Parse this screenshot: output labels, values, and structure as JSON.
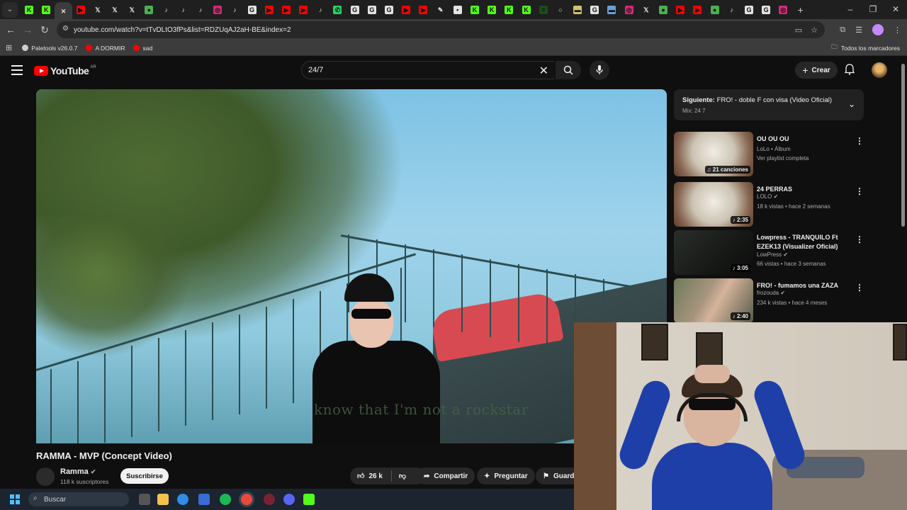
{
  "browser": {
    "tabs": [
      {
        "icon": "kick-icon",
        "color": "#53fc18",
        "glyph": "K"
      },
      {
        "icon": "kick-icon",
        "color": "#53fc18",
        "glyph": "K"
      },
      {
        "icon": "close-icon",
        "color": "#3c3c3c",
        "glyph": "✕",
        "active": true
      },
      {
        "icon": "youtube-icon",
        "color": "#ff0000",
        "glyph": "▶"
      },
      {
        "icon": "x-icon",
        "color": "#1f1f1f",
        "glyph": "𝕏"
      },
      {
        "icon": "x-icon",
        "color": "#1f1f1f",
        "glyph": "𝕏"
      },
      {
        "icon": "x-icon",
        "color": "#1f1f1f",
        "glyph": "𝕏"
      },
      {
        "icon": "xbox-icon",
        "color": "#4caf50",
        "glyph": "●"
      },
      {
        "icon": "tiktok-icon",
        "color": "#1f1f1f",
        "glyph": "♪"
      },
      {
        "icon": "tiktok-icon",
        "color": "#1f1f1f",
        "glyph": "♪"
      },
      {
        "icon": "tiktok-icon",
        "color": "#1f1f1f",
        "glyph": "♪"
      },
      {
        "icon": "instagram-icon",
        "color": "#d62976",
        "glyph": "◎"
      },
      {
        "icon": "tiktok-icon",
        "color": "#1f1f1f",
        "glyph": "♪"
      },
      {
        "icon": "chrome-icon",
        "color": "#e3e3e3",
        "glyph": "G"
      },
      {
        "icon": "youtube-icon",
        "color": "#ff0000",
        "glyph": "▶"
      },
      {
        "icon": "youtube-icon",
        "color": "#ff0000",
        "glyph": "▶"
      },
      {
        "icon": "youtube-icon",
        "color": "#ff0000",
        "glyph": "▶"
      },
      {
        "icon": "tiktok-icon",
        "color": "#1f1f1f",
        "glyph": "♪"
      },
      {
        "icon": "whatsapp-icon",
        "color": "#25d366",
        "glyph": "✆"
      },
      {
        "icon": "chrome-icon",
        "color": "#e3e3e3",
        "glyph": "G"
      },
      {
        "icon": "chrome-icon",
        "color": "#e3e3e3",
        "glyph": "G"
      },
      {
        "icon": "chrome-icon",
        "color": "#e3e3e3",
        "glyph": "G"
      },
      {
        "icon": "youtube-icon",
        "color": "#ff0000",
        "glyph": "▶"
      },
      {
        "icon": "youtube-icon",
        "color": "#ff0000",
        "glyph": "▶"
      },
      {
        "icon": "page-icon",
        "color": "#1f1f1f",
        "glyph": "✎"
      },
      {
        "icon": "page-icon",
        "color": "#e3e3e3",
        "glyph": "▪"
      },
      {
        "icon": "kick-icon",
        "color": "#53fc18",
        "glyph": "K"
      },
      {
        "icon": "kick-icon",
        "color": "#53fc18",
        "glyph": "K"
      },
      {
        "icon": "kick-icon",
        "color": "#53fc18",
        "glyph": "K"
      },
      {
        "icon": "kick-icon",
        "color": "#53fc18",
        "glyph": "K"
      },
      {
        "icon": "terminal-icon",
        "color": "#1a4d1a",
        "glyph": "≡"
      },
      {
        "icon": "github-icon",
        "color": "#1f1f1f",
        "glyph": "○"
      },
      {
        "icon": "page-icon",
        "color": "#d4c36a",
        "glyph": "▬"
      },
      {
        "icon": "chrome-icon",
        "color": "#e3e3e3",
        "glyph": "G"
      },
      {
        "icon": "page-icon",
        "color": "#6aa0d4",
        "glyph": "▬"
      },
      {
        "icon": "instagram-icon",
        "color": "#d62976",
        "glyph": "◎"
      },
      {
        "icon": "x-icon",
        "color": "#1f1f1f",
        "glyph": "𝕏"
      },
      {
        "icon": "xbox-icon",
        "color": "#4caf50",
        "glyph": "●"
      },
      {
        "icon": "youtube-icon",
        "color": "#ff0000",
        "glyph": "▶"
      },
      {
        "icon": "youtube-icon",
        "color": "#ff0000",
        "glyph": "▶"
      },
      {
        "icon": "xbox-icon",
        "color": "#4caf50",
        "glyph": "●"
      },
      {
        "icon": "tiktok-icon",
        "color": "#1f1f1f",
        "glyph": "♪"
      },
      {
        "icon": "chrome-icon",
        "color": "#e3e3e3",
        "glyph": "G"
      },
      {
        "icon": "chrome-icon",
        "color": "#e3e3e3",
        "glyph": "G"
      },
      {
        "icon": "instagram-icon",
        "color": "#d62976",
        "glyph": "◎"
      }
    ],
    "new_tab_glyph": "+",
    "url": "youtube.com/watch?v=tTvDLtO3fPs&list=RDZUqAJ2aH-BE&index=2",
    "bookmarks": [
      {
        "label": "Paletools v26.0.7",
        "color": "#cfcfcf"
      },
      {
        "label": "A DORMIR",
        "color": "#ff0000"
      },
      {
        "label": "sad",
        "color": "#ff0000"
      }
    ],
    "all_bookmarks": "Todos los marcadores"
  },
  "youtube": {
    "logo_text": "YouTube",
    "country_code": "AR",
    "search_query": "24/7",
    "create_label": "Crear",
    "video": {
      "title": "RAMMA - MVP (Concept Video)",
      "subtitle_text": "know that I'm not a rockstar",
      "channel": "Ramma",
      "subscribers": "118 k suscriptores",
      "subscribe_label": "Suscribirse",
      "likes": "26 k",
      "share_label": "Compartir",
      "ask_label": "Preguntar",
      "save_label": "Guarda"
    },
    "next_up": {
      "prefix": "Siguiente:",
      "title": "FRO! - doble F con visa (Video Oficial)",
      "subtitle": "Mix: 24 7"
    },
    "recommendations": [
      {
        "title": "OU OU OU",
        "meta1": "LoLo • Álbum",
        "meta2": "Ver playlist completa",
        "badge": "21 canciones",
        "verified": false
      },
      {
        "title": "24 PERRAS",
        "meta1": "LOLO",
        "meta2": "18 k vistas • hace 2 semanas",
        "badge": "2:35",
        "verified": true
      },
      {
        "title": "Lowpress - TRANQUILO Ft EZEK13 (Visualizer Oficial)",
        "meta1": "LowPress",
        "meta2": "66 vistas • hace 3 semanas",
        "badge": "3:05",
        "verified": true
      },
      {
        "title": "FRO! - fumamos una ZAZA",
        "meta1": "frozouda",
        "meta2": "234 k vistas • hace 4 meses",
        "badge": "2:40",
        "verified": true
      }
    ]
  },
  "taskbar": {
    "search_placeholder": "Buscar"
  }
}
